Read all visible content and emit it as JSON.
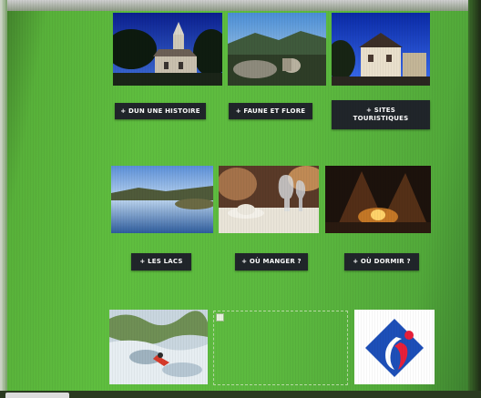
{
  "buttons": {
    "histoire": "+ DUN UNE HISTOIRE",
    "faune": "+ FAUNE ET FLORE",
    "sites_line1": "+ SITES",
    "sites_line2": "TOURISTIQUES",
    "lacs": "+ LES LACS",
    "manger": "+ OÙ MANGER ?",
    "dormir": "+ OÙ DORMIR ?"
  },
  "images": [
    {
      "name": "village-church-photo"
    },
    {
      "name": "wildlife-landscape-photo"
    },
    {
      "name": "historic-houses-photo"
    },
    {
      "name": "lake-photo"
    },
    {
      "name": "dining-table-photo"
    },
    {
      "name": "camping-night-photo"
    },
    {
      "name": "kayak-river-photo"
    },
    {
      "name": "broken-image-placeholder"
    },
    {
      "name": "regional-logo"
    }
  ],
  "colors": {
    "page_background": "#5cb93f",
    "button_background": "#20252a",
    "button_text": "#ffffff",
    "logo_blue": "#1d4fb8",
    "logo_red": "#e8203a"
  }
}
